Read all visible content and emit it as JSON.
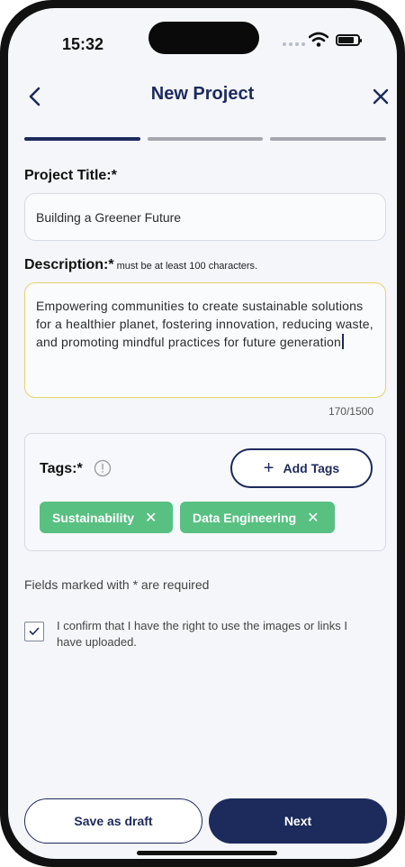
{
  "status_bar": {
    "time": "15:32"
  },
  "header": {
    "title": "New Project",
    "back_icon": "chevron-left-icon",
    "close_icon": "close-icon"
  },
  "progress": {
    "total_steps": 3,
    "current_step": 1
  },
  "form": {
    "title_label": "Project Title:*",
    "title_value": "Building a Greener Future",
    "description_label": "Description:*",
    "description_hint": "must be at least 100 characters.",
    "description_value": "Empowering communities to create sustainable solutions for a healthier planet, fostering innovation, reducing waste, and promoting mindful practices for future generation",
    "description_counter": "170/1500",
    "tags_label": "Tags:*",
    "add_tags_label": "Add Tags",
    "tags": [
      {
        "label": "Sustainability"
      },
      {
        "label": "Data Engineering"
      }
    ],
    "required_note": "Fields marked with * are required",
    "confirm_checked": true,
    "confirm_text": "I confirm that I have the right to use the images or links I have uploaded."
  },
  "footer": {
    "save_draft_label": "Save as draft",
    "next_label": "Next"
  },
  "colors": {
    "primary": "#1d2a5c",
    "tag_green": "#58c081",
    "focus_border": "#e2d36c",
    "background": "#f4f6fa"
  }
}
